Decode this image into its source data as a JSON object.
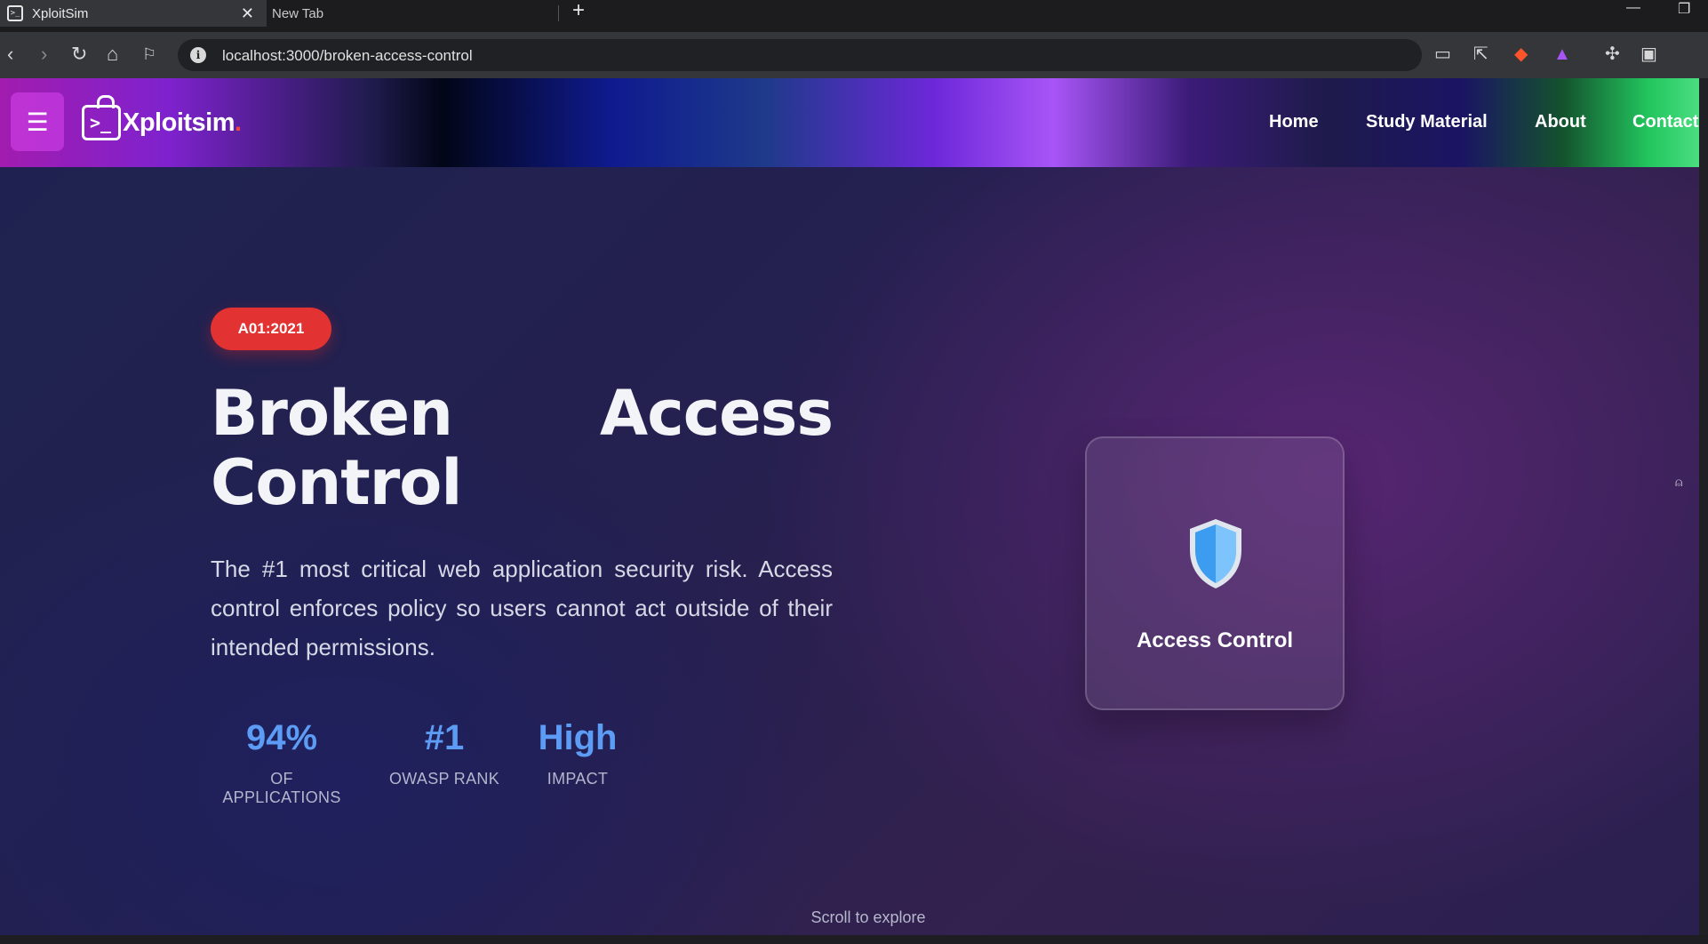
{
  "browser": {
    "tabs": [
      {
        "title": "XploitSim",
        "active": true
      },
      {
        "title": "New Tab",
        "active": false
      }
    ],
    "new_tab": "+",
    "url": "localhost:3000/broken-access-control"
  },
  "nav": {
    "menu_icon": "☰",
    "brand": "Xploitsim",
    "brand_dot": ".",
    "links": [
      "Home",
      "Study Material",
      "About",
      "Contact"
    ]
  },
  "hero": {
    "badge": "A01:2021",
    "title": "Broken Access Control",
    "description": "The #1 most critical web application security risk. Access control enforces policy so users cannot act outside of their intended permissions.",
    "stats": [
      {
        "value": "94%",
        "label": "OF APPLICATIONS"
      },
      {
        "value": "#1",
        "label": "OWASP RANK"
      },
      {
        "value": "High",
        "label": "IMPACT"
      }
    ],
    "card_title": "Access Control",
    "scroll_hint": "Scroll to explore"
  },
  "colors": {
    "badge": "#e23232",
    "stat_value": "#5d9cf5",
    "shield": "#3b9cf0"
  }
}
